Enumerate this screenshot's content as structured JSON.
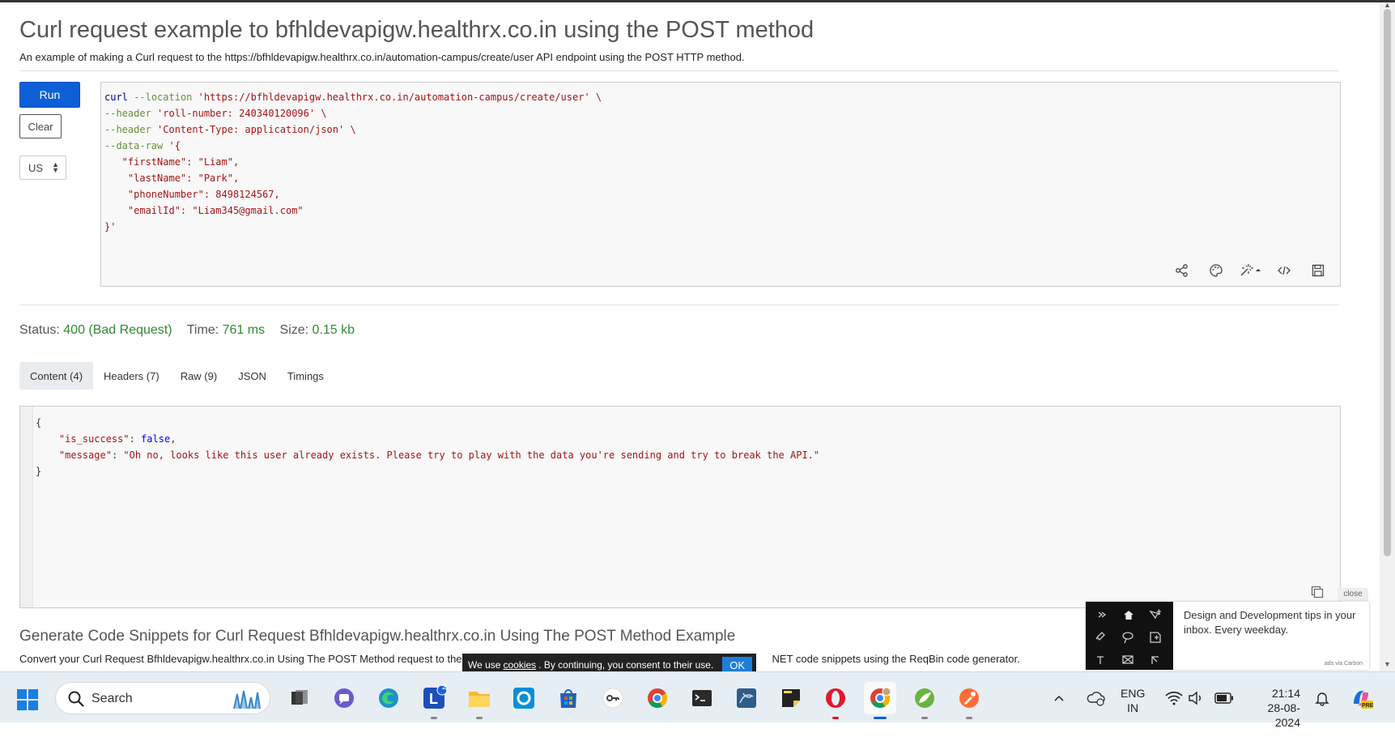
{
  "page": {
    "title": "Curl request example to bfhldevapigw.healthrx.co.in using the POST method",
    "subtitle": "An example of making a Curl request to the https://bfhldevapigw.healthrx.co.in/automation-campus/create/user API endpoint using the POST HTTP method."
  },
  "controls": {
    "run_label": "Run",
    "clear_label": "Clear",
    "region_value": "US"
  },
  "request": {
    "line1_cmd": "curl",
    "line1_flag": "--location",
    "line1_url": "'https://bfhldevapigw.healthrx.co.in/automation-campus/create/user' \\",
    "line2_flag": "--header",
    "line2_val": "'roll-number: 240340120096' \\",
    "line3_flag": "--header",
    "line3_val": "'Content-Type: application/json' \\",
    "line4_flag": "--data-raw",
    "line4_val": "'{",
    "line5": "   \"firstName\": \"Liam\",",
    "line6": "    \"lastName\": \"Park\",",
    "line7": "    \"phoneNumber\": 8498124567,",
    "line8": "    \"emailId\": \"Liam345@gmail.com\"",
    "line9": "}'"
  },
  "editor_tools": [
    "share-icon",
    "palette-icon",
    "magic-wand-icon",
    "code-icon",
    "save-icon"
  ],
  "status": {
    "status_label": "Status:",
    "status_value": "400 (Bad Request)",
    "time_label": "Time:",
    "time_value": "761 ms",
    "size_label": "Size:",
    "size_value": "0.15 kb"
  },
  "tabs": [
    {
      "label": "Content (4)",
      "active": true
    },
    {
      "label": "Headers (7)",
      "active": false
    },
    {
      "label": "Raw (9)",
      "active": false
    },
    {
      "label": "JSON",
      "active": false
    },
    {
      "label": "Timings",
      "active": false
    }
  ],
  "response": {
    "open": "{",
    "k1": "\"is_success\"",
    "v1": "false",
    "k2": "\"message\"",
    "v2": "\"Oh no, looks like this user already exists. Please try to play with the data you're sending and try to break the API.\"",
    "close": "}"
  },
  "generate": {
    "title": "Generate Code Snippets for Curl Request Bfhldevapigw.healthrx.co.in Using The POST Method Example",
    "desc_left": "Convert your Curl Request Bfhldevapigw.healthrx.co.in Using The POST Method request to the",
    "desc_right": "NET code snippets using the ReqBin code generator."
  },
  "cookie": {
    "pre": "We use",
    "link": "cookies",
    "post": ". By continuing, you consent to their use.",
    "ok": "OK"
  },
  "carbon_ad": {
    "close": "close",
    "text": "Design and Development tips in your inbox. Every weekday.",
    "via": "ads via Carbon"
  },
  "taskbar": {
    "search_placeholder": "Search",
    "lang_line1": "ENG",
    "lang_line2": "IN",
    "time": "21:14",
    "date": "28-08-2024",
    "badge": "2"
  },
  "colors": {
    "accent": "#0d5fd8",
    "status_ok_text": "#2e8b2e",
    "opera": "#e0192b"
  }
}
